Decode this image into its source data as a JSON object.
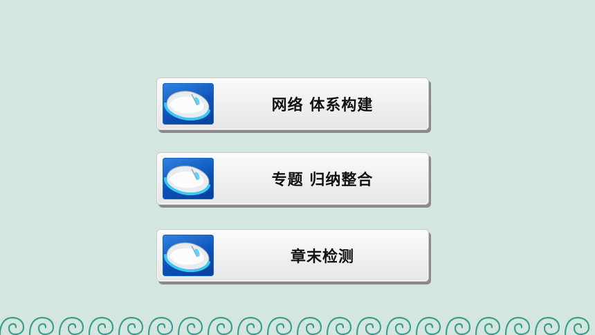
{
  "menu": {
    "items": [
      {
        "label": "网络 体系构建",
        "icon": "mouse-icon"
      },
      {
        "label": "专题 归纳整合",
        "icon": "mouse-icon"
      },
      {
        "label": "章末检测",
        "icon": "mouse-icon"
      }
    ]
  },
  "theme": {
    "background": "#d3e6e0",
    "icon_tile": "#0d52b8",
    "border_pattern": "#3c9f8c"
  }
}
